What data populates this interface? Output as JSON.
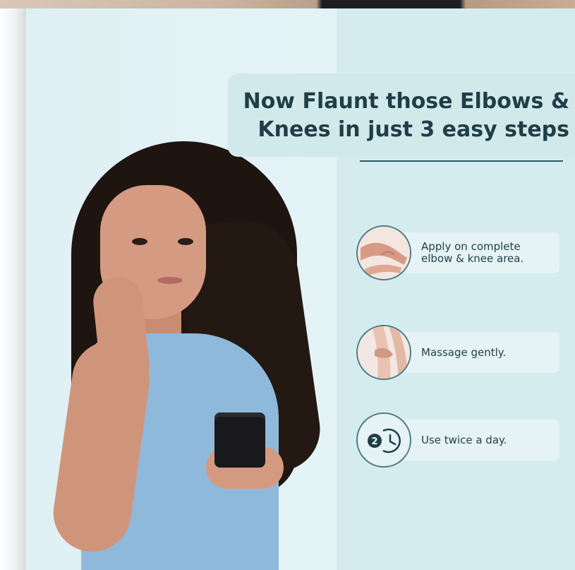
{
  "headline": {
    "line1": "Now Flaunt those Elbows &",
    "line2": "Knees in just 3 easy steps"
  },
  "steps": [
    {
      "icon": "elbow-icon",
      "line1": "Apply on complete",
      "line2": "elbow & knee area."
    },
    {
      "icon": "knee-massage-icon",
      "line1": "Massage gently.",
      "line2": ""
    },
    {
      "icon": "clock-twice-icon",
      "line1": "Use twice a day.",
      "line2": ""
    }
  ],
  "colors": {
    "background": "#dff0f4",
    "accent": "#1f3e47",
    "dress": "#8fb9da"
  }
}
